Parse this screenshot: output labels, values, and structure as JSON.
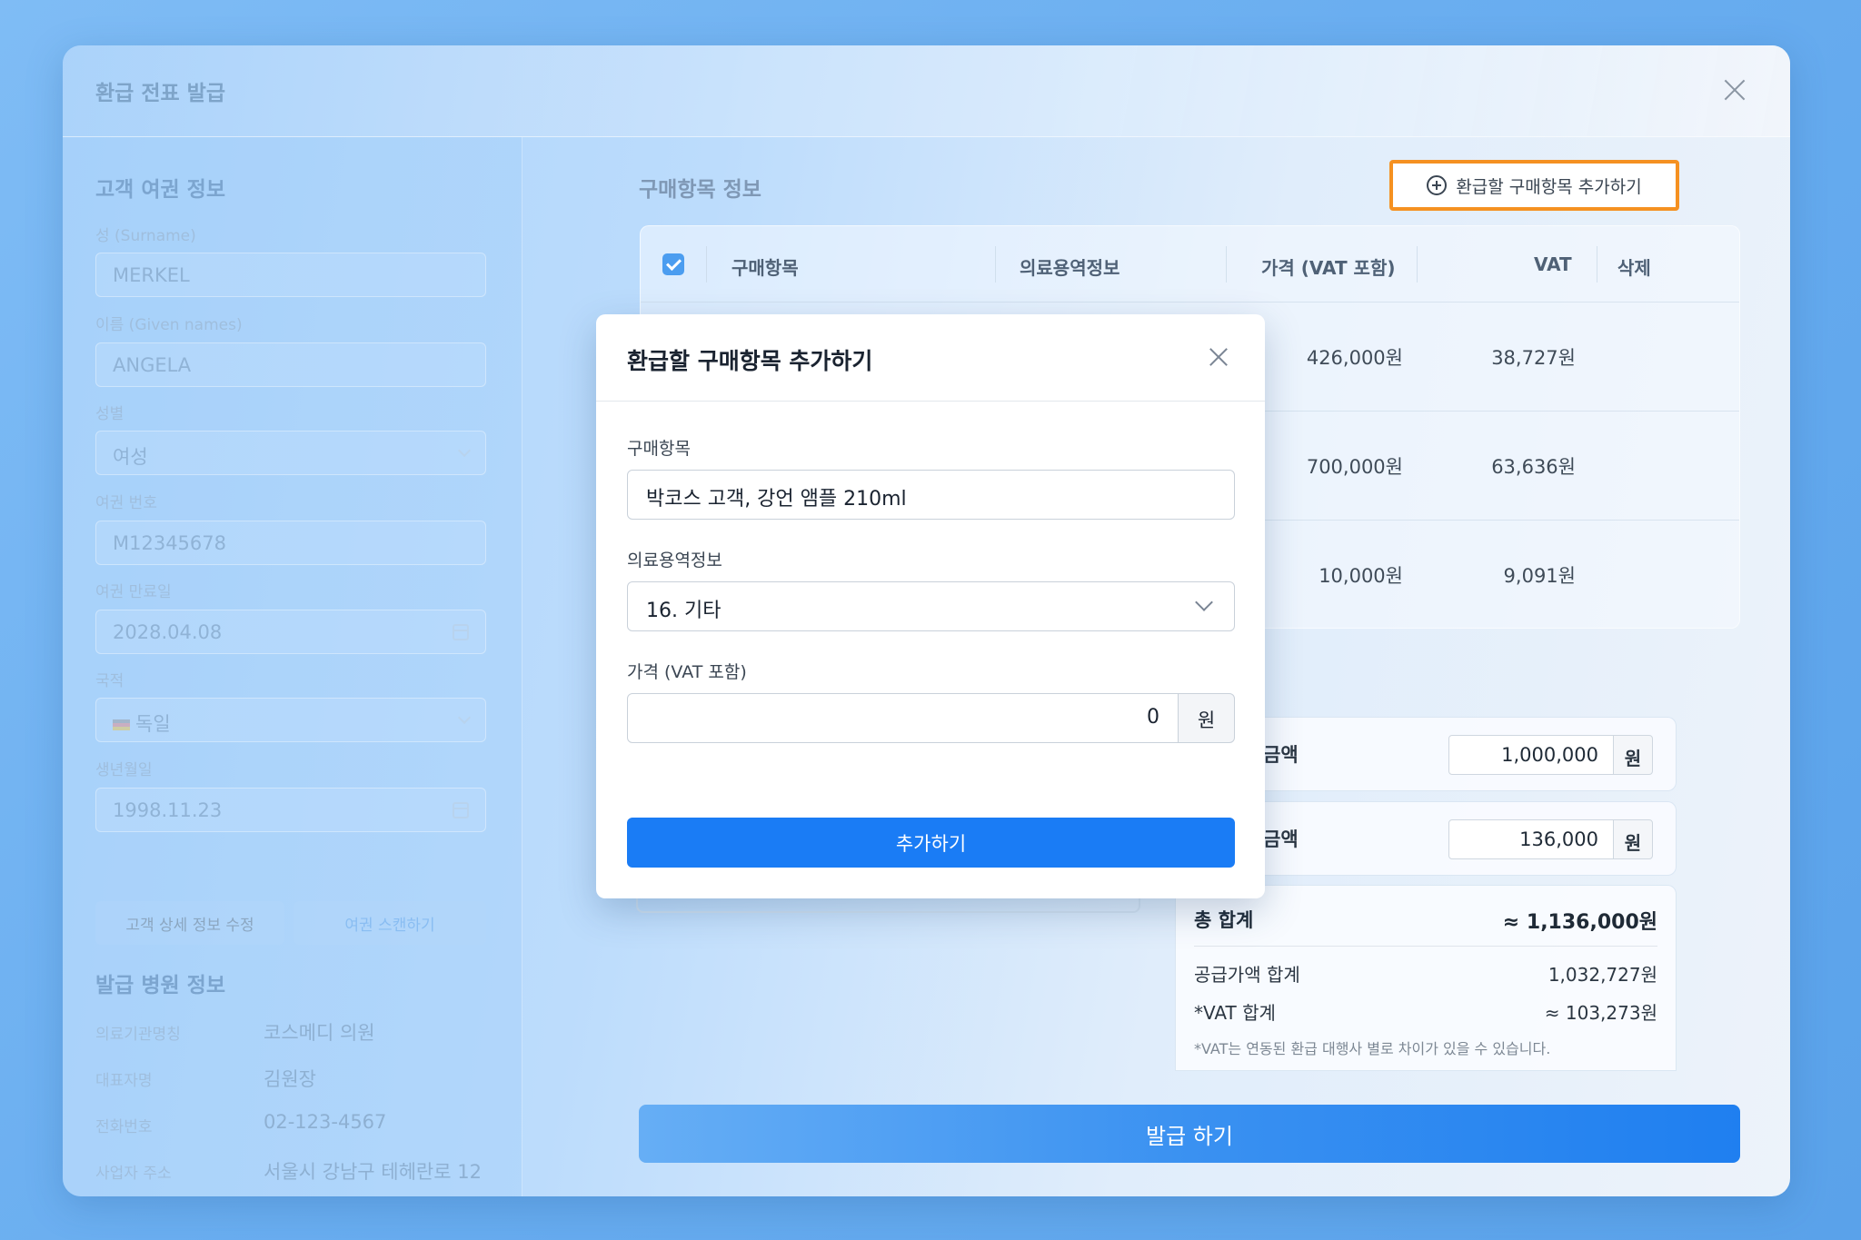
{
  "window": {
    "title": "환급 전표 발급"
  },
  "passport": {
    "section_title": "고객 여권 정보",
    "surname_label": "성 (Surname)",
    "surname_value": "MERKEL",
    "given_label": "이름 (Given names)",
    "given_value": "ANGELA",
    "gender_label": "성별",
    "gender_value": "여성",
    "passport_no_label": "여권 번호",
    "passport_no_value": "M12345678",
    "expiry_label": "여권 만료일",
    "expiry_value": "2028.04.08",
    "nationality_label": "국적",
    "nationality_value": "독일",
    "birth_label": "생년월일",
    "birth_value": "1998.11.23",
    "edit_button": "고객 상세 정보 수정",
    "scan_button": "여권 스캔하기"
  },
  "hospital": {
    "section_title": "발급 병원 정보",
    "rows": [
      {
        "label": "의료기관명칭",
        "value": "코스메디 의원"
      },
      {
        "label": "대표자명",
        "value": "김원장"
      },
      {
        "label": "전화번호",
        "value": "02-123-4567"
      },
      {
        "label": "사업자 주소",
        "value": "서울시 강남구 테헤란로 12"
      }
    ]
  },
  "items": {
    "section_title": "구매항목 정보",
    "add_button": "환급할 구매항목 추가하기",
    "columns": {
      "item": "구매항목",
      "medical": "의료용역정보",
      "price": "가격 (VAT 포함)",
      "vat": "VAT",
      "delete": "삭제"
    },
    "rows": [
      {
        "price": "426,000원",
        "vat": "38,727원"
      },
      {
        "price": "700,000원",
        "vat": "63,636원"
      },
      {
        "price": "10,000원",
        "vat": "9,091원"
      }
    ]
  },
  "summary": {
    "row1_label": "금액",
    "row1_value": "1,000,000",
    "row2_label": "금액",
    "row2_value": "136,000",
    "unit": "원",
    "total_label": "총 합계",
    "total_value": "≈ 1,136,000원",
    "supply_label": "공급가액 합계",
    "supply_value": "1,032,727원",
    "vat_label": "*VAT 합계",
    "vat_value": "≈ 103,273원",
    "note": "*VAT는 연동된 환급 대행사 별로 차이가 있을 수 있습니다."
  },
  "issue_button": "발급 하기",
  "modal": {
    "title": "환급할 구매항목 추가하기",
    "item_label": "구매항목",
    "item_value": "박코스 고객, 강언 앰플 210ml",
    "medical_label": "의료용역정보",
    "medical_value": "16. 기타",
    "price_label": "가격 (VAT 포함)",
    "price_value": "0",
    "price_unit": "원",
    "submit": "추가하기"
  },
  "colors": {
    "accent": "#1a7cf5",
    "highlight": "#f59121"
  }
}
